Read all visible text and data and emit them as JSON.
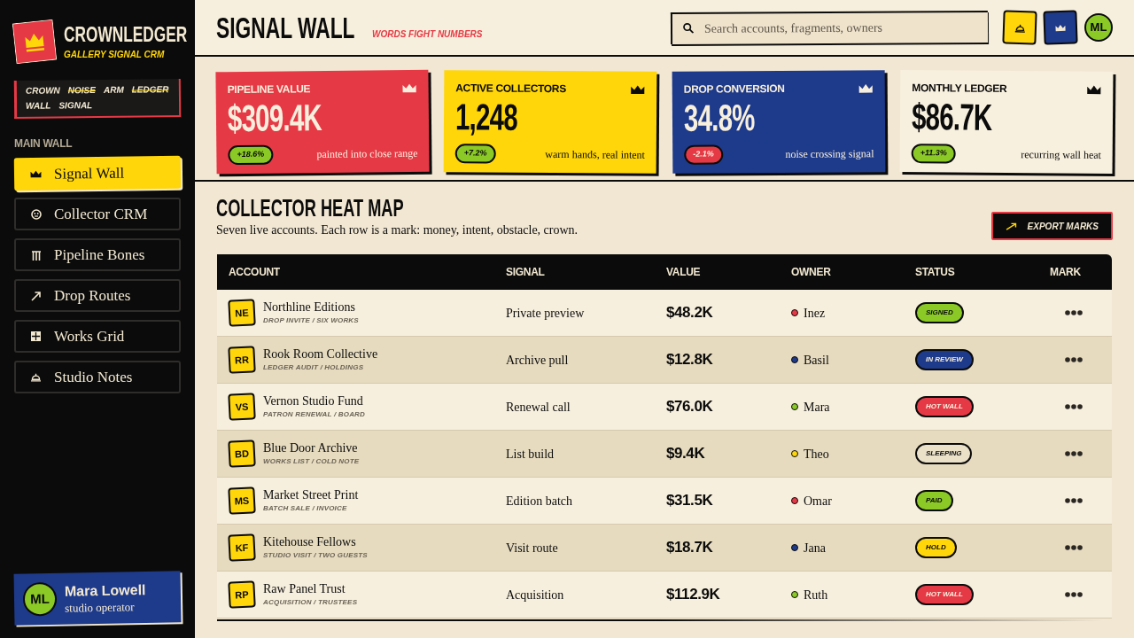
{
  "sidebar": {
    "brand": {
      "name": "CROWNLEDGER",
      "tagline": "GALLERY SIGNAL CRM"
    },
    "motto_words": [
      {
        "text": "CROWN",
        "struck": false
      },
      {
        "text": "NOISE",
        "struck": true
      },
      {
        "text": "ARM",
        "struck": false
      },
      {
        "text": "LEDGER",
        "struck": true
      },
      {
        "text": "WALL",
        "struck": false
      },
      {
        "text": "SIGNAL",
        "struck": false
      }
    ],
    "section_label": "MAIN WALL",
    "items": [
      {
        "label": "Signal Wall",
        "selected": true
      },
      {
        "label": "Collector CRM",
        "selected": false
      },
      {
        "label": "Pipeline Bones",
        "selected": false
      },
      {
        "label": "Drop Routes",
        "selected": false
      },
      {
        "label": "Works Grid",
        "selected": false
      },
      {
        "label": "Studio Notes",
        "selected": false
      }
    ],
    "user": {
      "initials": "ML",
      "name": "Mara Lowell",
      "role": "studio operator"
    }
  },
  "header": {
    "title": "SIGNAL WALL",
    "tagline": "WORDS FIGHT NUMBERS",
    "search": {
      "placeholder": "Search accounts, fragments, owners"
    },
    "avatar": "ML"
  },
  "kpis": [
    {
      "label": "PIPELINE VALUE",
      "value": "$309.4K",
      "delta": "+18.6%",
      "negative": false,
      "caption": "painted into close range",
      "color": "#e63946"
    },
    {
      "label": "ACTIVE COLLECTORS",
      "value": "1,248",
      "delta": "+7.2%",
      "negative": false,
      "caption": "warm hands, real intent",
      "color": "#ffd60a"
    },
    {
      "label": "DROP CONVERSION",
      "value": "34.8%",
      "delta": "-2.1%",
      "negative": true,
      "caption": "noise crossing signal",
      "color": "#1e3a8a"
    },
    {
      "label": "MONTHLY LEDGER",
      "value": "$86.7K",
      "delta": "+11.3%",
      "negative": false,
      "caption": "recurring wall heat",
      "color": "#f8f0de"
    }
  ],
  "heat_map": {
    "title": "COLLECTOR HEAT MAP",
    "subtitle": "Seven live accounts. Each row is a mark: money, intent, obstacle, crown.",
    "export_button": "EXPORT MARKS",
    "columns": [
      "ACCOUNT",
      "SIGNAL",
      "VALUE",
      "OWNER",
      "STATUS",
      "MARK"
    ],
    "rows": [
      {
        "initials": "NE",
        "name": "Northline Editions",
        "detail": "DROP INVITE / SIX WORKS",
        "signal": "Private preview",
        "value": "$48.2K",
        "owner": {
          "name": "Inez",
          "color": "#e63946"
        },
        "status": {
          "label": "SIGNED",
          "color": "#8ac926"
        }
      },
      {
        "initials": "RR",
        "name": "Rook Room Collective",
        "detail": "LEDGER AUDIT / HOLDINGS",
        "signal": "Archive pull",
        "value": "$12.8K",
        "owner": {
          "name": "Basil",
          "color": "#1e3a8a"
        },
        "status": {
          "label": "IN REVIEW",
          "color": "#1e3a8a"
        }
      },
      {
        "initials": "VS",
        "name": "Vernon Studio Fund",
        "detail": "PATRON RENEWAL / BOARD",
        "signal": "Renewal call",
        "value": "$76.0K",
        "owner": {
          "name": "Mara",
          "color": "#8ac926"
        },
        "status": {
          "label": "HOT WALL",
          "color": "#e63946"
        }
      },
      {
        "initials": "BD",
        "name": "Blue Door Archive",
        "detail": "WORKS LIST / COLD NOTE",
        "signal": "List build",
        "value": "$9.4K",
        "owner": {
          "name": "Theo",
          "color": "#ffd60a"
        },
        "status": {
          "label": "SLEEPING",
          "color": "#ebe1c9"
        }
      },
      {
        "initials": "MS",
        "name": "Market Street Print",
        "detail": "BATCH SALE / INVOICE",
        "signal": "Edition batch",
        "value": "$31.5K",
        "owner": {
          "name": "Omar",
          "color": "#e63946"
        },
        "status": {
          "label": "PAID",
          "color": "#8ac926"
        }
      },
      {
        "initials": "KF",
        "name": "Kitehouse Fellows",
        "detail": "STUDIO VISIT / TWO GUESTS",
        "signal": "Visit route",
        "value": "$18.7K",
        "owner": {
          "name": "Jana",
          "color": "#1e3a8a"
        },
        "status": {
          "label": "HOLD",
          "color": "#ffd60a"
        }
      },
      {
        "initials": "RP",
        "name": "Raw Panel Trust",
        "detail": "ACQUISITION / TRUSTEES",
        "signal": "Acquisition",
        "value": "$112.9K",
        "owner": {
          "name": "Ruth",
          "color": "#8ac926"
        },
        "status": {
          "label": "HOT WALL",
          "color": "#e63946"
        }
      }
    ]
  }
}
